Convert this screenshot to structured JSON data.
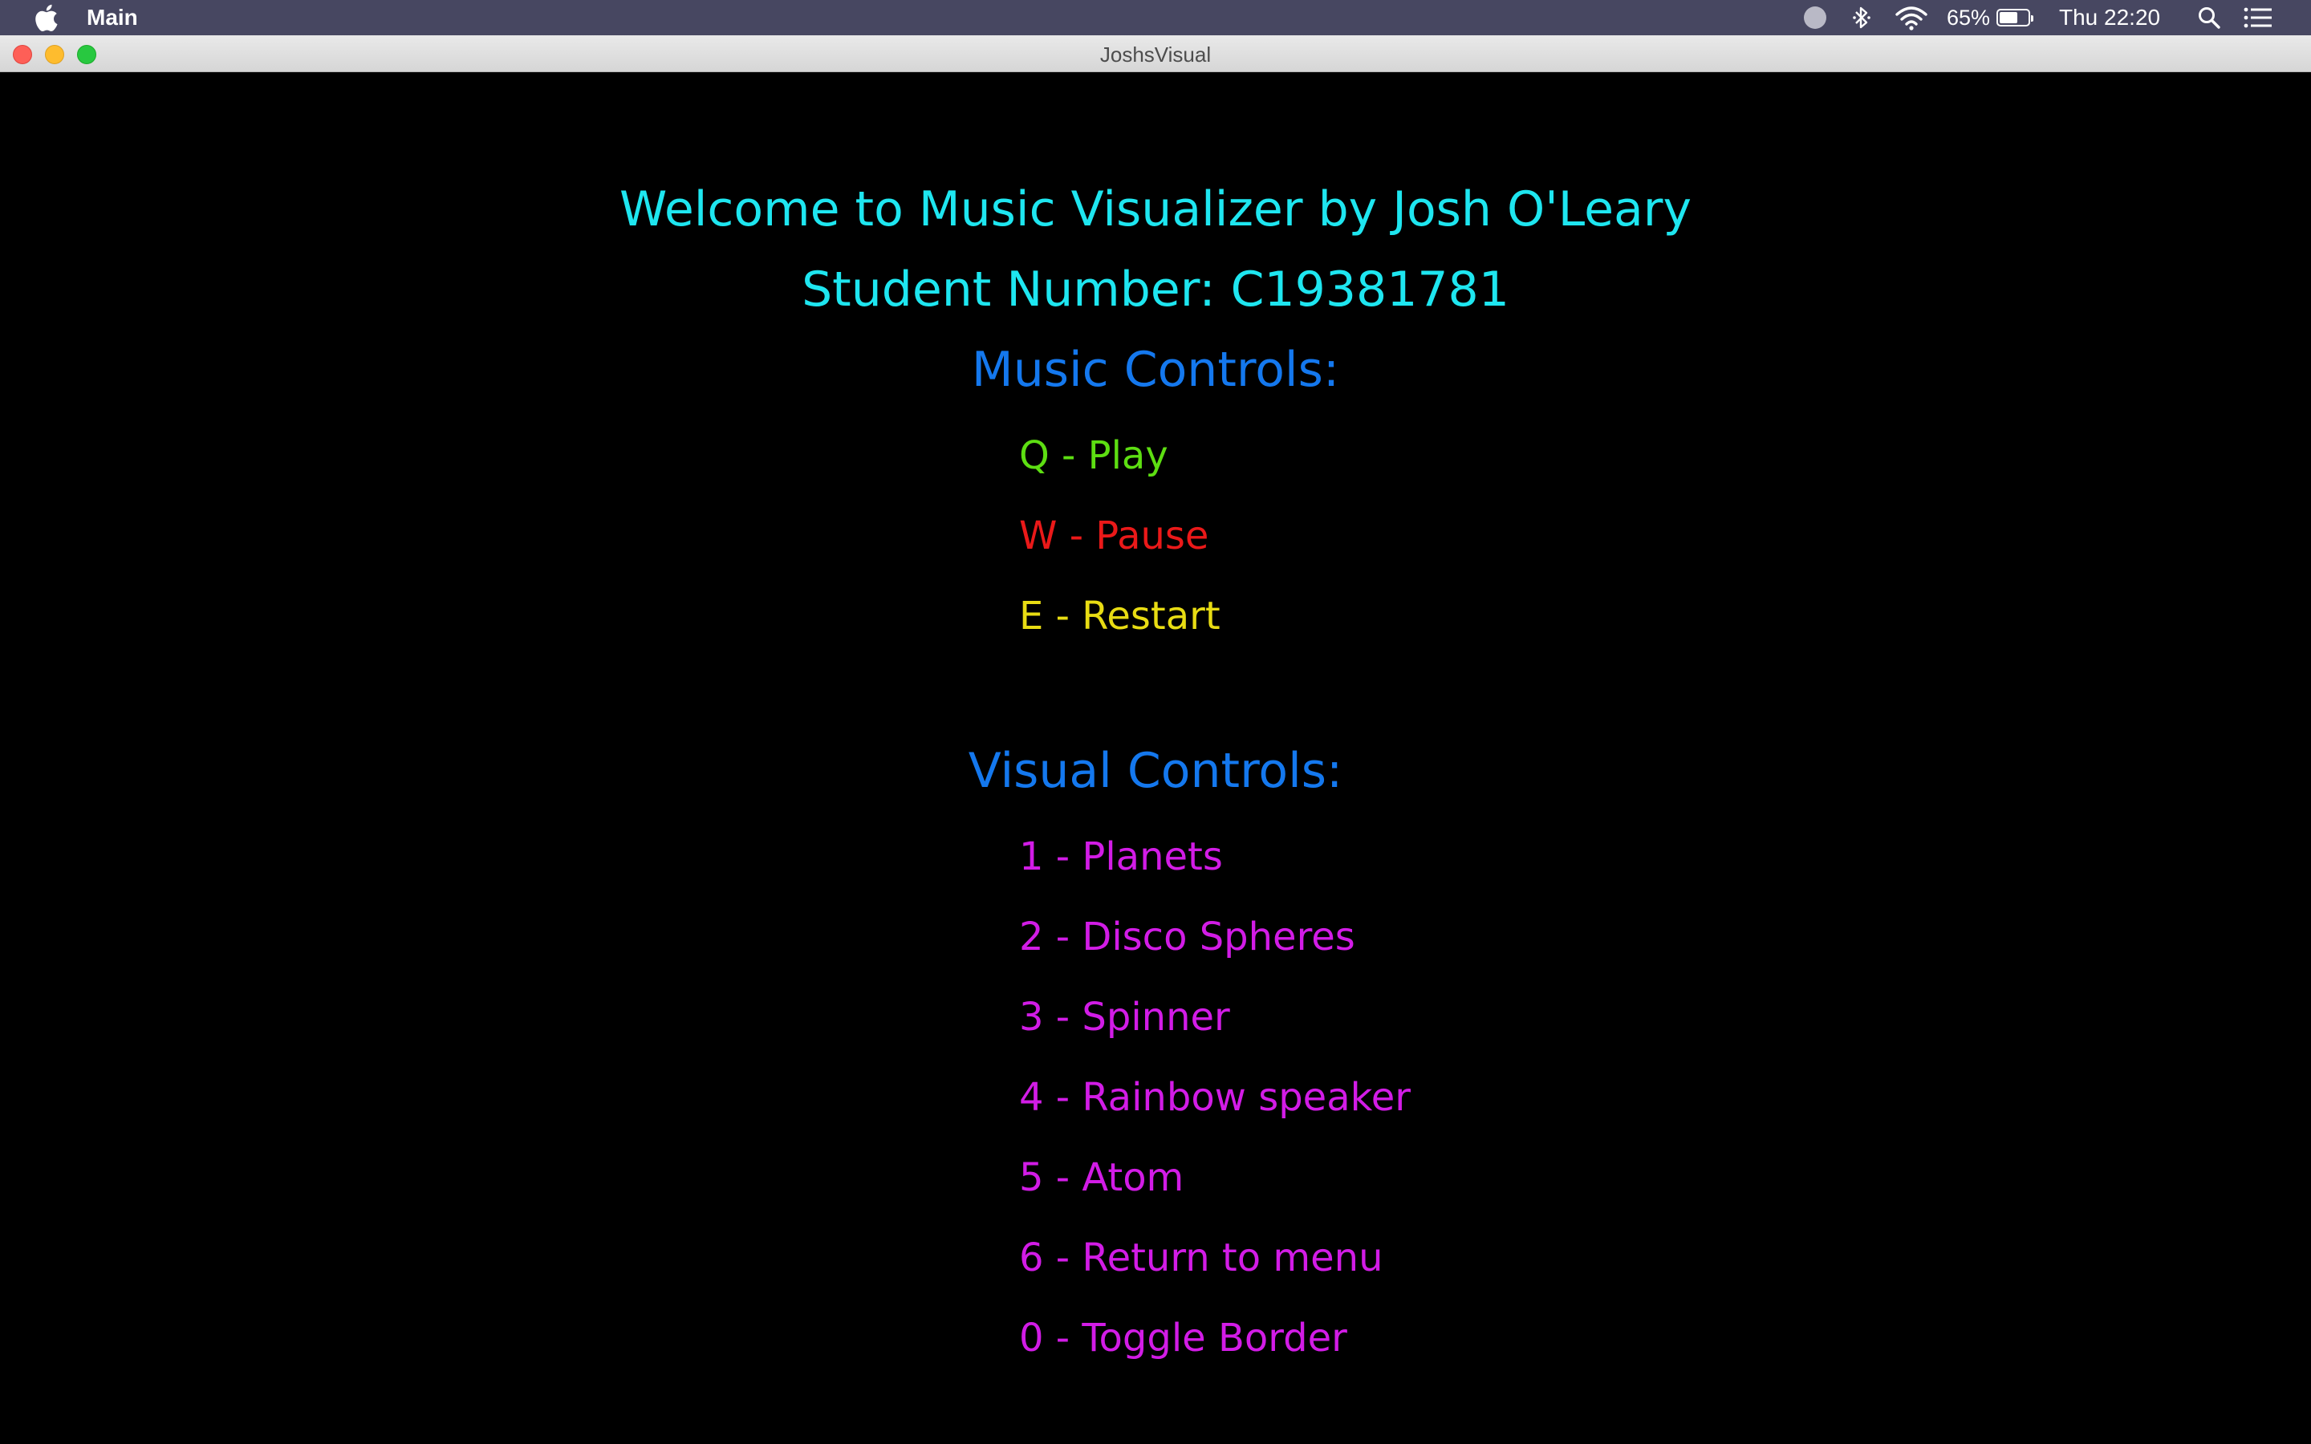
{
  "menubar": {
    "app_name": "Main",
    "apple_icon": "apple-logo-icon",
    "battery_percent": "65%",
    "battery_level": 0.65,
    "clock": "Thu 22:20",
    "icons": [
      "recording-indicator-icon",
      "bluetooth-icon",
      "wifi-icon",
      "battery-icon",
      "spotlight-search-icon",
      "notification-center-icon"
    ]
  },
  "window": {
    "title": "JoshsVisual"
  },
  "sketch": {
    "welcome_line": "Welcome to Music Visualizer by Josh O'Leary",
    "student_line": "Student Number: C19381781",
    "music_heading": "Music Controls:",
    "music_controls": [
      {
        "label": "Q - Play",
        "color": "#5dde12"
      },
      {
        "label": "W - Pause",
        "color": "#ea1919"
      },
      {
        "label": "E - Restart",
        "color": "#e8dc13"
      }
    ],
    "visual_heading": "Visual Controls:",
    "visual_controls": [
      {
        "label": "1 - Planets"
      },
      {
        "label": "2 - Disco Spheres"
      },
      {
        "label": "3 - Spinner"
      },
      {
        "label": "4 - Rainbow speaker"
      },
      {
        "label": "5 - Atom"
      },
      {
        "label": "6 - Return to menu"
      },
      {
        "label": "0 - Toggle Border"
      }
    ],
    "colors": {
      "title": "#1ee6f0",
      "heading": "#1478ee",
      "visual_control": "#d21ce6",
      "background": "#000000"
    }
  }
}
